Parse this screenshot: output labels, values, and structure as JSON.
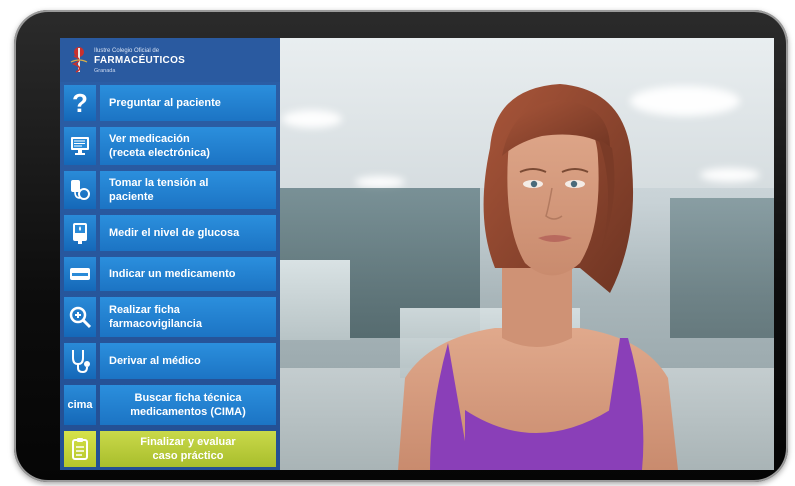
{
  "header": {
    "org_line1": "Ilustre Colegio Oficial de",
    "org_name": "FARMACÉUTICOS",
    "org_city": "Granada"
  },
  "menu": [
    {
      "label": "Preguntar al paciente",
      "icon": "question-icon"
    },
    {
      "label": "Ver medicación\n(receta electrónica)",
      "icon": "monitor-icon"
    },
    {
      "label": "Tomar la tensión al\npaciente",
      "icon": "blood-pressure-icon"
    },
    {
      "label": "Medir el nivel de glucosa",
      "icon": "glucometer-icon"
    },
    {
      "label": "Indicar un medicamento",
      "icon": "medication-card-icon"
    },
    {
      "label": "Realizar ficha\nfarmacovigilancia",
      "icon": "magnifier-plus-icon"
    },
    {
      "label": "Derivar al médico",
      "icon": "stethoscope-icon"
    },
    {
      "label": "Buscar ficha técnica\nmedicamentos (CIMA)",
      "icon": "cima-icon",
      "icon_text": "cima"
    },
    {
      "label": "Finalizar y evaluar\ncaso práctico",
      "icon": "clipboard-icon"
    }
  ],
  "colors": {
    "sidebar": "#2c5fa7",
    "button": "#1f7fd0",
    "final_button": "#b8c93a",
    "shirt": "#8a3fb8"
  }
}
